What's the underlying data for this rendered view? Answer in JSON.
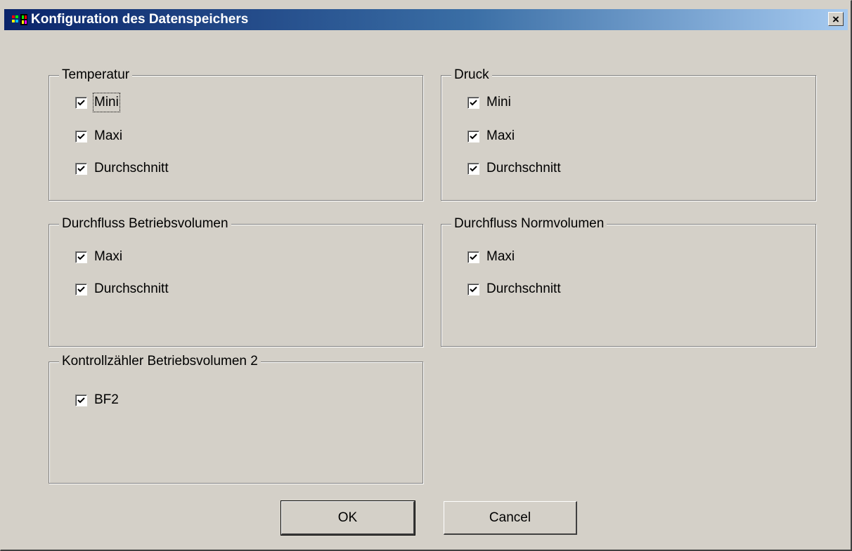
{
  "window": {
    "title": "Konfiguration des Datenspeichers",
    "close_label": "×"
  },
  "groups": {
    "temperatur": {
      "title": "Temperatur",
      "items": [
        {
          "label": "Mini",
          "checked": true
        },
        {
          "label": "Maxi",
          "checked": true
        },
        {
          "label": "Durchschnitt",
          "checked": true
        }
      ]
    },
    "druck": {
      "title": "Druck",
      "items": [
        {
          "label": "Mini",
          "checked": true
        },
        {
          "label": "Maxi",
          "checked": true
        },
        {
          "label": "Durchschnitt",
          "checked": true
        }
      ]
    },
    "durchfluss_betrieb": {
      "title": "Durchfluss Betriebsvolumen",
      "items": [
        {
          "label": "Maxi",
          "checked": true
        },
        {
          "label": "Durchschnitt",
          "checked": true
        }
      ]
    },
    "durchfluss_norm": {
      "title": "Durchfluss  Normvolumen",
      "items": [
        {
          "label": "Maxi",
          "checked": true
        },
        {
          "label": "Durchschnitt",
          "checked": true
        }
      ]
    },
    "kontrollzaehler": {
      "title": "Kontrollzähler Betriebsvolumen 2",
      "items": [
        {
          "label": "BF2",
          "checked": true
        }
      ]
    }
  },
  "buttons": {
    "ok": "OK",
    "cancel": "Cancel"
  }
}
